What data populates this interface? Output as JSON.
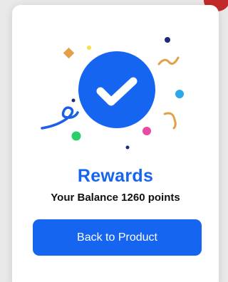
{
  "colors": {
    "accent": "#1565f0",
    "confetti": [
      "#e8a247",
      "#f5e04a",
      "#1a237e",
      "#29a9e8",
      "#e94aa6",
      "#2ecc71"
    ]
  },
  "card": {
    "icon": "check-circle-icon",
    "title": "Rewards",
    "balance_text": "Your Balance 1260 points",
    "button_label": "Back to Product"
  }
}
